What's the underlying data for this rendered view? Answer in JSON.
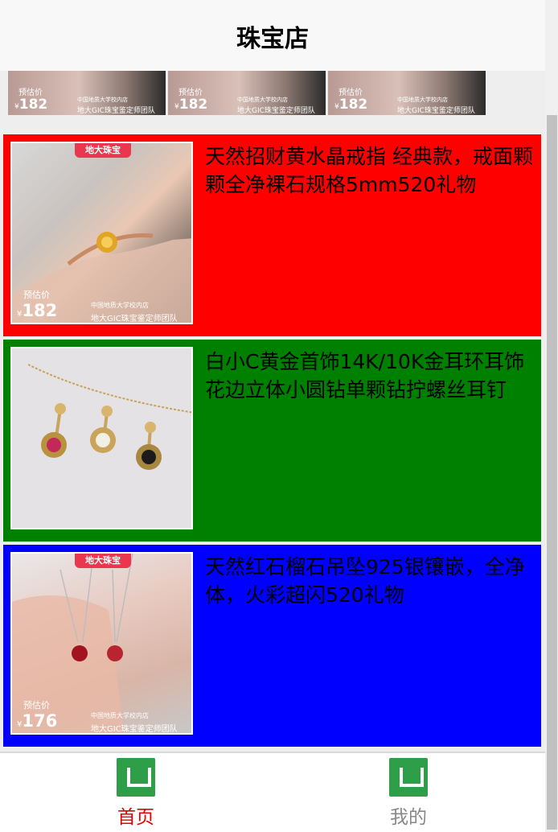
{
  "header": {
    "title": "珠宝店"
  },
  "banner": {
    "tiles": [
      {
        "price_label": "预估价",
        "currency": "¥",
        "price": "182",
        "store": "中国地质大学校内店",
        "team": "地大GIC珠宝鉴定师团队"
      },
      {
        "price_label": "预估价",
        "currency": "¥",
        "price": "182",
        "store": "中国地质大学校内店",
        "team": "地大GIC珠宝鉴定师团队"
      },
      {
        "price_label": "预估价",
        "currency": "¥",
        "price": "182",
        "store": "中国地质大学校内店",
        "team": "地大GIC珠宝鉴定师团队"
      }
    ]
  },
  "products": [
    {
      "bg_color": "#ff0000",
      "name": "天然招财黄水晶戒指 经典款，戒面颗颗全净裸石规格5mm520礼物",
      "image": {
        "tag": "地大珠宝",
        "price_label": "预估价",
        "currency": "¥",
        "price": "182",
        "store": "中国地质大学校内店",
        "team": "地大GIC珠宝鉴定师团队"
      }
    },
    {
      "bg_color": "#008000",
      "name": "白小C黄金首饰14K/10K金耳环耳饰花边立体小圆钻单颗钻拧螺丝耳钉"
    },
    {
      "bg_color": "#0000ff",
      "name": "天然红石榴石吊坠925银镶嵌，全净体，火彩超闪520礼物",
      "image": {
        "tag": "地大珠宝",
        "price_label": "预估价",
        "currency": "¥",
        "price": "176",
        "store": "中国地质大学校内店",
        "team": "地大GIC珠宝鉴定师团队"
      }
    }
  ],
  "tabbar": {
    "items": [
      {
        "label": "首页",
        "icon": "home-icon",
        "active": true,
        "color": "#e60000"
      },
      {
        "label": "我的",
        "icon": "profile-icon",
        "active": false,
        "color": "#888888"
      }
    ]
  }
}
